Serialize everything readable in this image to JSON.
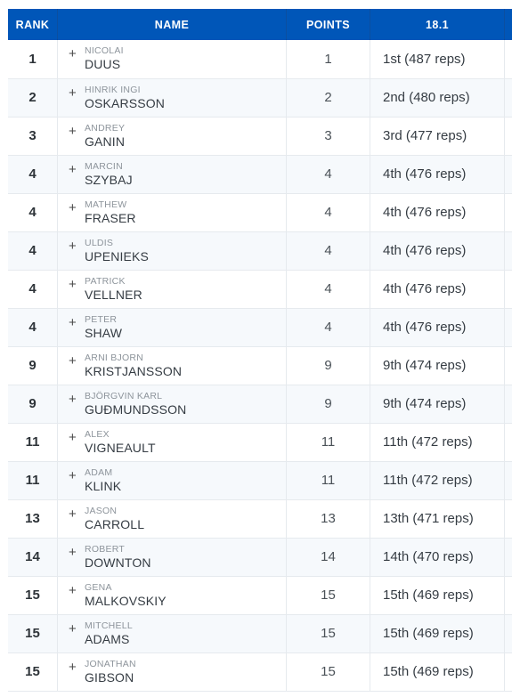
{
  "table": {
    "columns": [
      {
        "key": "rank",
        "label": "RANK"
      },
      {
        "key": "name",
        "label": "NAME"
      },
      {
        "key": "points",
        "label": "POINTS"
      },
      {
        "key": "score",
        "label": "18.1"
      },
      {
        "key": "extra",
        "label": ""
      }
    ],
    "expand_icon": "+",
    "header_bg": "#0056b8",
    "header_text_color": "#ffffff",
    "row_alt_bg": "#f6f9fc",
    "border_color": "#e6eaee",
    "rows": [
      {
        "rank": "1",
        "first_name": "NICOLAI",
        "last_name": "DUUS",
        "points": "1",
        "score": "1st (487 reps)"
      },
      {
        "rank": "2",
        "first_name": "HINRIK INGI",
        "last_name": "OSKARSSON",
        "points": "2",
        "score": "2nd (480 reps)"
      },
      {
        "rank": "3",
        "first_name": "ANDREY",
        "last_name": "GANIN",
        "points": "3",
        "score": "3rd (477 reps)"
      },
      {
        "rank": "4",
        "first_name": "MARCIN",
        "last_name": "SZYBAJ",
        "points": "4",
        "score": "4th (476 reps)"
      },
      {
        "rank": "4",
        "first_name": "MATHEW",
        "last_name": "FRASER",
        "points": "4",
        "score": "4th (476 reps)"
      },
      {
        "rank": "4",
        "first_name": "ULDIS",
        "last_name": "UPENIEKS",
        "points": "4",
        "score": "4th (476 reps)"
      },
      {
        "rank": "4",
        "first_name": "PATRICK",
        "last_name": "VELLNER",
        "points": "4",
        "score": "4th (476 reps)"
      },
      {
        "rank": "4",
        "first_name": "PETER",
        "last_name": "SHAW",
        "points": "4",
        "score": "4th (476 reps)"
      },
      {
        "rank": "9",
        "first_name": "ARNI BJORN",
        "last_name": "KRISTJANSSON",
        "points": "9",
        "score": "9th (474 reps)"
      },
      {
        "rank": "9",
        "first_name": "BJÖRGVIN KARL",
        "last_name": "GUÐMUNDSSON",
        "points": "9",
        "score": "9th (474 reps)"
      },
      {
        "rank": "11",
        "first_name": "ALEX",
        "last_name": "VIGNEAULT",
        "points": "11",
        "score": "11th (472 reps)"
      },
      {
        "rank": "11",
        "first_name": "ADAM",
        "last_name": "KLINK",
        "points": "11",
        "score": "11th (472 reps)"
      },
      {
        "rank": "13",
        "first_name": "JASON",
        "last_name": "CARROLL",
        "points": "13",
        "score": "13th (471 reps)"
      },
      {
        "rank": "14",
        "first_name": "ROBERT",
        "last_name": "DOWNTON",
        "points": "14",
        "score": "14th (470 reps)"
      },
      {
        "rank": "15",
        "first_name": "GENA",
        "last_name": "MALKOVSKIY",
        "points": "15",
        "score": "15th (469 reps)"
      },
      {
        "rank": "15",
        "first_name": "MITCHELL",
        "last_name": "ADAMS",
        "points": "15",
        "score": "15th (469 reps)"
      },
      {
        "rank": "15",
        "first_name": "JONATHAN",
        "last_name": "GIBSON",
        "points": "15",
        "score": "15th (469 reps)"
      }
    ]
  }
}
